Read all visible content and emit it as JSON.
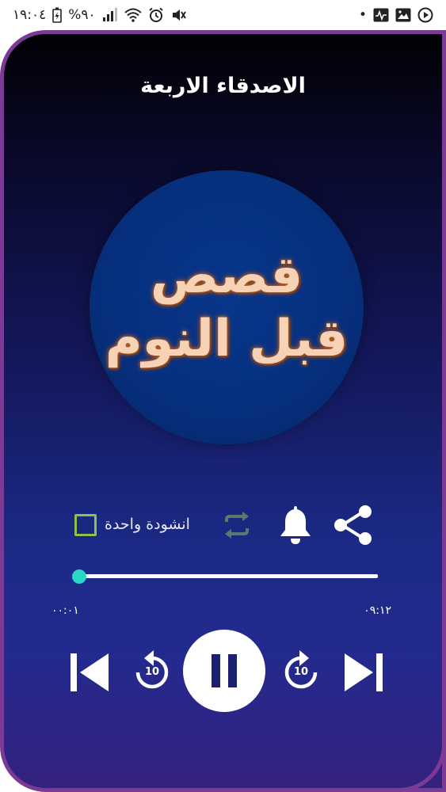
{
  "status_bar": {
    "time": "١٩:٠٤",
    "battery": "%٩٠",
    "notification_dot": "•"
  },
  "player": {
    "title": "الاصدقاء الاربعة",
    "cover_line_1": "قصص",
    "cover_line_2": "قبل النوم",
    "one_track_label": "انشودة واحدة",
    "one_track_checked": false,
    "elapsed": "٠٠:٠١",
    "duration": "٠٩:١٢",
    "progress_fraction": 0.01,
    "rewind_seconds": "10",
    "forward_seconds": "10",
    "state": "playing"
  },
  "colors": {
    "frame_border": "#7b3a96",
    "checkbox_border": "#8bc34a",
    "slider_thumb": "#2ad7c4",
    "repeat_icon": "#5a7a70"
  }
}
